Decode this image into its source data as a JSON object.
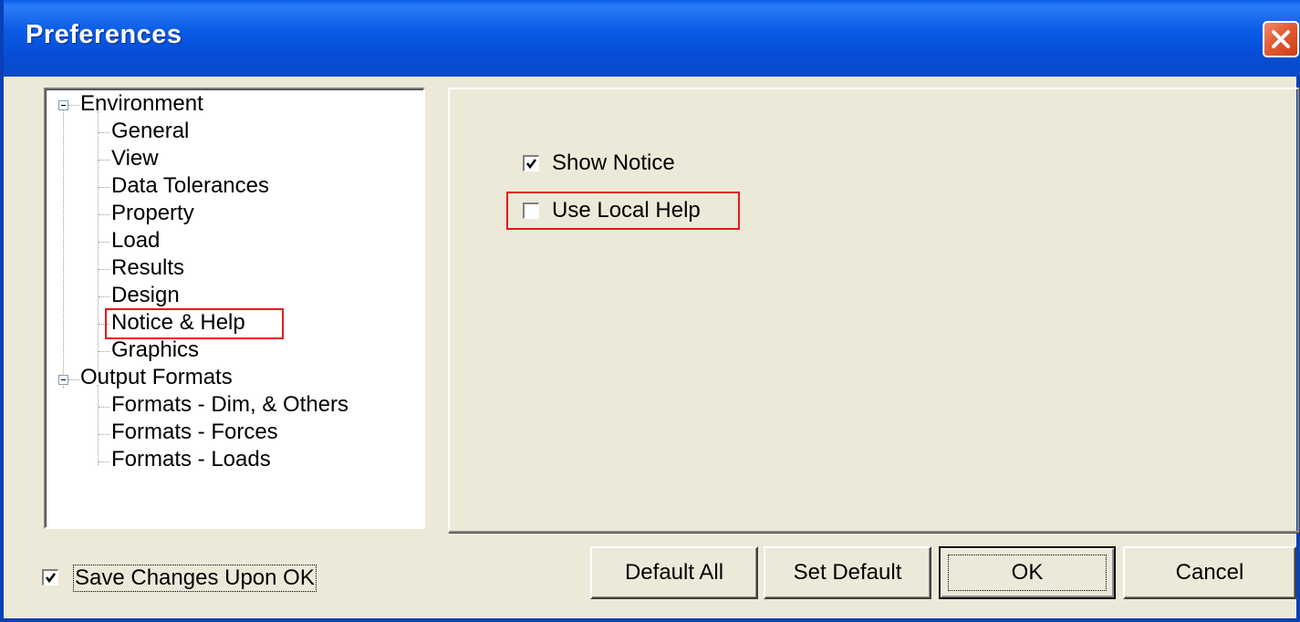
{
  "window": {
    "title": "Preferences"
  },
  "tree": {
    "env": "Environment",
    "general": "General",
    "view": "View",
    "tolerances": "Data Tolerances",
    "property": "Property",
    "load": "Load",
    "results": "Results",
    "design": "Design",
    "notice": "Notice & Help",
    "graphics": "Graphics",
    "output": "Output Formats",
    "fmt_dim": "Formats - Dim, & Others",
    "fmt_forces": "Formats - Forces",
    "fmt_loads": "Formats - Loads",
    "selected": "Notice & Help"
  },
  "options": {
    "show_notice": {
      "label": "Show Notice",
      "checked": true
    },
    "use_local_help": {
      "label": "Use Local Help",
      "checked": false
    }
  },
  "footer": {
    "save_changes": {
      "label": "Save Changes Upon OK",
      "checked": true
    },
    "buttons": {
      "default_all": "Default All",
      "set_default": "Set Default",
      "ok": "OK",
      "cancel": "Cancel"
    }
  },
  "colors": {
    "titlebar": "#0a5fe8",
    "highlight": "#e8151b",
    "face": "#ece9d8"
  }
}
